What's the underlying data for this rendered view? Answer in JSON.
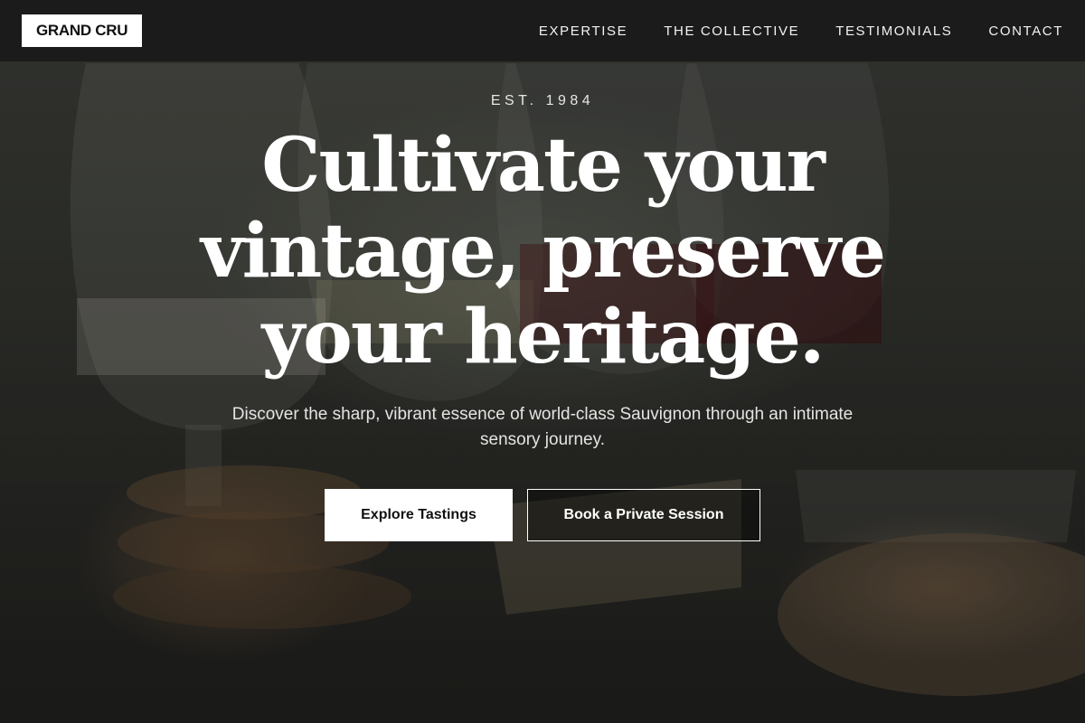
{
  "brand": {
    "logo_text": "GRAND CRU"
  },
  "nav": {
    "items": [
      {
        "label": "EXPERTISE"
      },
      {
        "label": "THE COLLECTIVE"
      },
      {
        "label": "TESTIMONIALS"
      },
      {
        "label": "CONTACT"
      }
    ]
  },
  "hero": {
    "eyebrow": "EST. 1984",
    "headline": "Cultivate your vintage, preserve your heritage.",
    "subtext": "Discover the sharp, vibrant essence of world-class Sauvignon through an intimate sensory journey.",
    "primary_cta": "Explore Tastings",
    "secondary_cta": "Book a Private Session"
  },
  "colors": {
    "header_bg": "#1b1b1b",
    "text_light": "#ffffff",
    "button_primary_bg": "#ffffff"
  }
}
